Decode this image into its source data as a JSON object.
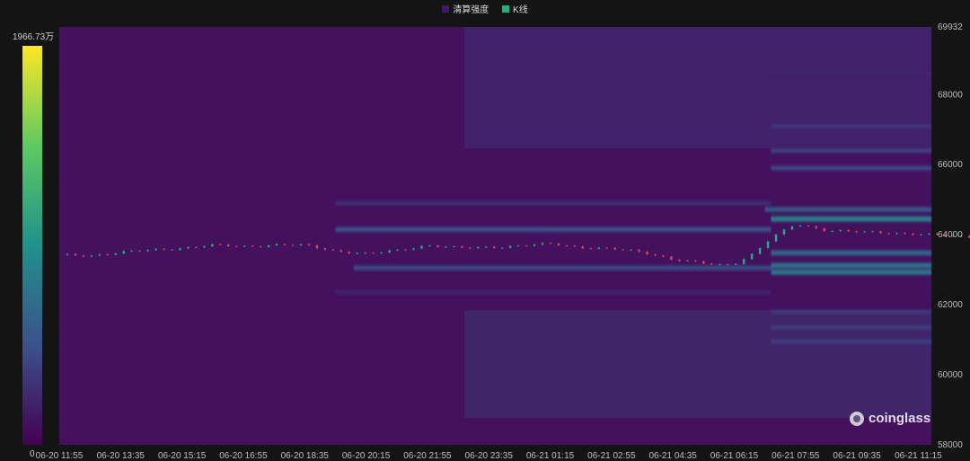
{
  "legend": [
    {
      "label": "清算强度",
      "color": "#3d1a66"
    },
    {
      "label": "K线",
      "color": "#21b07e"
    }
  ],
  "colorbar": {
    "max_label": "1966.73万",
    "min_label": "0"
  },
  "watermark": "coinglass",
  "chart_data": {
    "type": "heatmap",
    "title": "",
    "series": [
      {
        "name": "清算强度"
      },
      {
        "name": "K线"
      }
    ],
    "x_tick_labels": [
      "06-20 11:55",
      "06-20 13:35",
      "06-20 15:15",
      "06-20 16:55",
      "06-20 18:35",
      "06-20 20:15",
      "06-20 21:55",
      "06-20 23:35",
      "06-21 01:15",
      "06-21 02:55",
      "06-21 04:35",
      "06-21 06:15",
      "06-21 07:55",
      "06-21 09:35",
      "06-21 11:15"
    ],
    "y_tick_labels": [
      "69932",
      "68000",
      "66000",
      "64000",
      "62000",
      "60000",
      "58000"
    ],
    "y_ticks": [
      69932,
      68000,
      66000,
      64000,
      62000,
      60000,
      58000
    ],
    "ylim": [
      58000,
      69932
    ],
    "colorscale": {
      "min": 0,
      "max": 19667300,
      "colors": [
        "#440154",
        "#3b528b",
        "#21918c",
        "#5ec962",
        "#fde725"
      ]
    },
    "price_path": [
      [
        0,
        63420
      ],
      [
        0.5,
        63400
      ],
      [
        1,
        63500
      ],
      [
        1.5,
        63560
      ],
      [
        2,
        63620
      ],
      [
        2.5,
        63700
      ],
      [
        3,
        63660
      ],
      [
        3.6,
        63720
      ],
      [
        4,
        63690
      ],
      [
        4.5,
        63540
      ],
      [
        5,
        63450
      ],
      [
        5.5,
        63550
      ],
      [
        6,
        63700
      ],
      [
        6.5,
        63620
      ],
      [
        7,
        63640
      ],
      [
        7.5,
        63680
      ],
      [
        8,
        63740
      ],
      [
        8.5,
        63640
      ],
      [
        9,
        63600
      ],
      [
        9.5,
        63500
      ],
      [
        10,
        63300
      ],
      [
        10.5,
        63180
      ],
      [
        10.8,
        63120
      ],
      [
        11,
        63180
      ],
      [
        11.3,
        63450
      ],
      [
        11.6,
        63900
      ],
      [
        12,
        64300
      ],
      [
        12.5,
        64130
      ],
      [
        13,
        64080
      ],
      [
        14,
        64020
      ],
      [
        14.5,
        63960
      ],
      [
        15,
        63920
      ],
      [
        16,
        63940
      ],
      [
        17,
        63830
      ],
      [
        18,
        63900
      ],
      [
        19,
        63940
      ],
      [
        20,
        63980
      ],
      [
        21,
        64040
      ],
      [
        22,
        64120
      ],
      [
        23,
        64150
      ],
      [
        23.3,
        64300
      ],
      [
        24,
        64310
      ],
      [
        25,
        64280
      ],
      [
        26,
        64260
      ],
      [
        27,
        64250
      ],
      [
        27.5,
        64300
      ],
      [
        28,
        64220
      ],
      [
        29,
        64230
      ],
      [
        30,
        64250
      ],
      [
        31,
        64320
      ],
      [
        31.5,
        64420
      ]
    ],
    "liquidation_bands": [
      {
        "price": 64720,
        "intensity": 0.82,
        "from": 25.0,
        "to": 31.5
      },
      {
        "price": 64450,
        "intensity": 0.45,
        "from": 11.6,
        "to": 31.5
      },
      {
        "price": 64720,
        "intensity": 0.3,
        "from": 11.5,
        "to": 25.0
      },
      {
        "price": 63120,
        "intensity": 0.4,
        "from": 11.6,
        "to": 31.5
      },
      {
        "price": 62930,
        "intensity": 0.42,
        "from": 11.6,
        "to": 31.5
      },
      {
        "price": 63480,
        "intensity": 0.36,
        "from": 11.6,
        "to": 31.5
      },
      {
        "price": 64150,
        "intensity": 0.28,
        "from": 4.5,
        "to": 11.6
      },
      {
        "price": 63050,
        "intensity": 0.26,
        "from": 4.8,
        "to": 11.6
      },
      {
        "price": 65900,
        "intensity": 0.24,
        "from": 11.6,
        "to": 31.5
      },
      {
        "price": 66400,
        "intensity": 0.22,
        "from": 11.6,
        "to": 31.5
      },
      {
        "price": 61350,
        "intensity": 0.2,
        "from": 11.6,
        "to": 31.5
      },
      {
        "price": 60950,
        "intensity": 0.2,
        "from": 11.6,
        "to": 31.5
      },
      {
        "price": 61800,
        "intensity": 0.18,
        "from": 11.6,
        "to": 31.5
      },
      {
        "price": 67100,
        "intensity": 0.18,
        "from": 11.6,
        "to": 31.5
      },
      {
        "price": 68600,
        "intensity": 0.12,
        "from": 11.6,
        "to": 31.5
      },
      {
        "price": 64900,
        "intensity": 0.15,
        "from": 4.5,
        "to": 11.6
      },
      {
        "price": 62350,
        "intensity": 0.13,
        "from": 4.5,
        "to": 11.6
      }
    ]
  }
}
